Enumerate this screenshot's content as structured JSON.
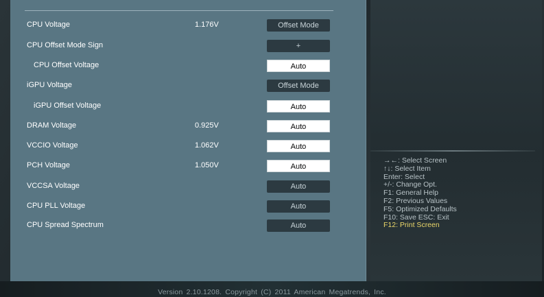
{
  "settings": [
    {
      "label": "CPU Voltage",
      "value": "1.176V",
      "control": "Offset Mode",
      "style": "dark"
    },
    {
      "label": "CPU Offset Mode Sign",
      "value": "",
      "control": "+",
      "style": "dark"
    },
    {
      "label": "CPU Offset Voltage",
      "value": "",
      "control": "Auto",
      "style": "light",
      "indent": true
    },
    {
      "label": "iGPU Voltage",
      "value": "",
      "control": "Offset Mode",
      "style": "dark"
    },
    {
      "label": "iGPU Offset Voltage",
      "value": "",
      "control": "Auto",
      "style": "light",
      "indent": true
    },
    {
      "label": "DRAM Voltage",
      "value": "0.925V",
      "control": "Auto",
      "style": "light"
    },
    {
      "label": "VCCIO Voltage",
      "value": "1.062V",
      "control": "Auto",
      "style": "light"
    },
    {
      "label": "PCH Voltage",
      "value": "1.050V",
      "control": "Auto",
      "style": "light"
    },
    {
      "label": "VCCSA Voltage",
      "value": "",
      "control": "Auto",
      "style": "dark"
    },
    {
      "label": "CPU PLL Voltage",
      "value": "",
      "control": "Auto",
      "style": "dark"
    },
    {
      "label": "CPU Spread Spectrum",
      "value": "",
      "control": "Auto",
      "style": "dark"
    }
  ],
  "help": [
    {
      "text": "→←: Select Screen"
    },
    {
      "text": "↑↓: Select Item"
    },
    {
      "text": "Enter: Select"
    },
    {
      "text": "+/-: Change Opt."
    },
    {
      "text": "F1: General Help"
    },
    {
      "text": "F2: Previous Values"
    },
    {
      "text": "F5: Optimized Defaults"
    },
    {
      "text": "F10: Save   ESC: Exit"
    },
    {
      "text": "F12: Print Screen",
      "highlight": true
    }
  ],
  "footer": {
    "version_text": "Version 2.10.1208. Copyright (C) 2011 American Megatrends, Inc."
  }
}
